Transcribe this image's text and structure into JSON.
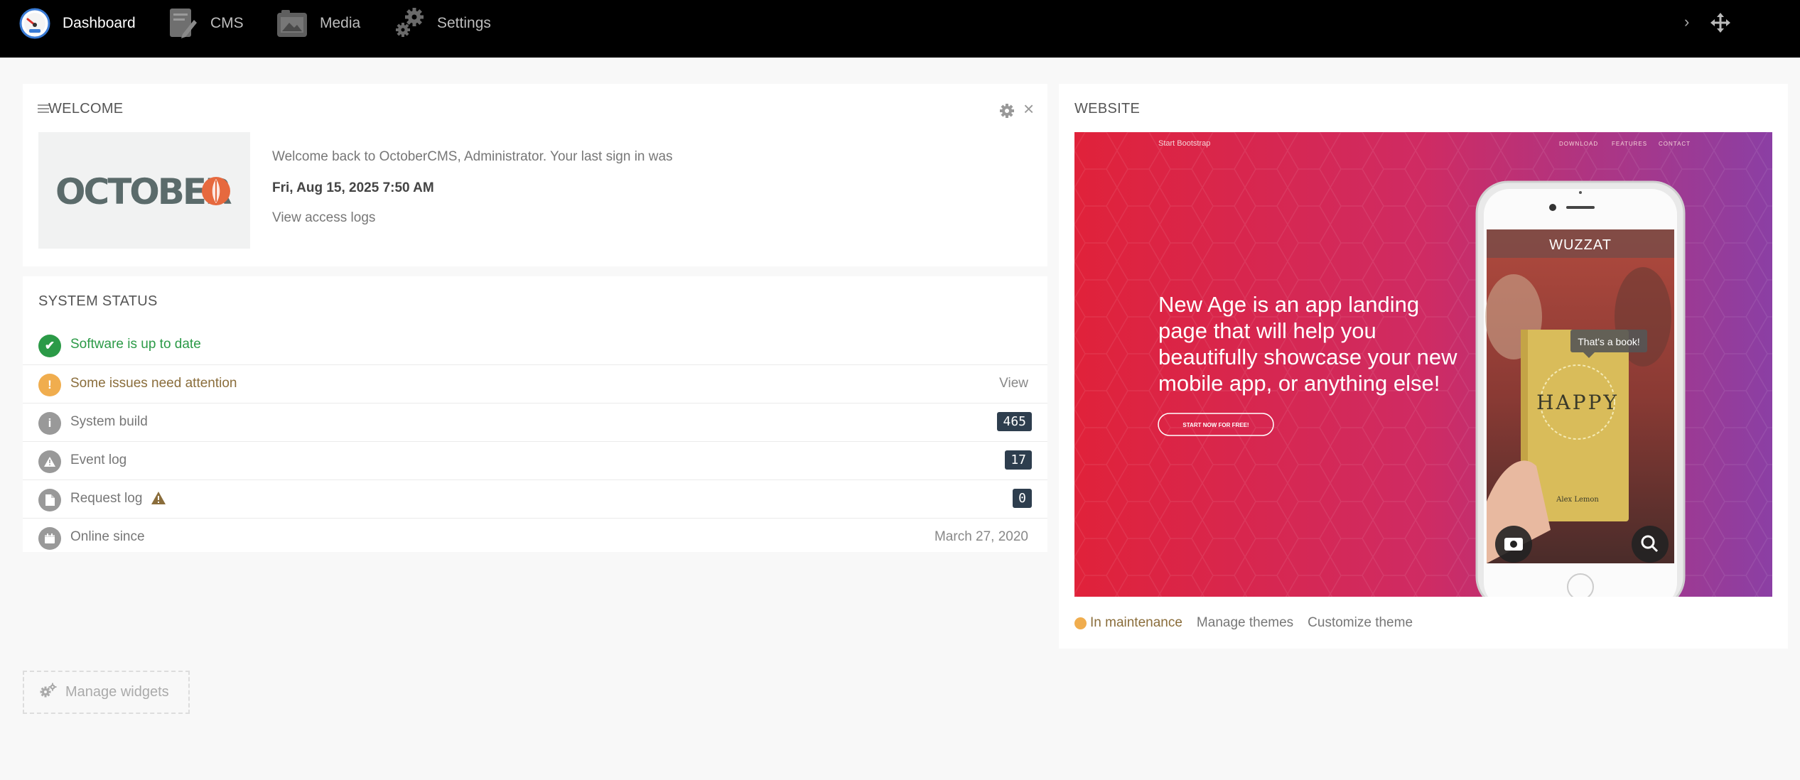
{
  "nav": {
    "items": [
      {
        "label": "Dashboard",
        "icon": "dashboard-gauge-icon"
      },
      {
        "label": "CMS",
        "icon": "cms-pages-icon"
      },
      {
        "label": "Media",
        "icon": "media-icon"
      },
      {
        "label": "Settings",
        "icon": "settings-gears-icon"
      }
    ],
    "right_icons": [
      "chevron-right-icon",
      "move-arrows-icon"
    ]
  },
  "welcome": {
    "title": "WELCOME",
    "logo_text": "OCTOBER",
    "message": "Welcome back to OctoberCMS, Administrator. Your last sign in was",
    "last_signin": "Fri, Aug 15, 2025 7:50 AM",
    "access_logs_link": "View access logs"
  },
  "system_status": {
    "title": "SYSTEM STATUS",
    "rows": [
      {
        "label": "Software is up to date",
        "icon": "check-circle-icon",
        "status": "success"
      },
      {
        "label": "Some issues need attention",
        "icon": "warning-circle-icon",
        "status": "warning",
        "action": "View"
      },
      {
        "label": "System build",
        "icon": "info-circle-icon",
        "badge": "465"
      },
      {
        "label": "Event log",
        "icon": "alert-triangle-icon",
        "badge": "17"
      },
      {
        "label": "Request log",
        "icon": "document-icon",
        "badge": "0",
        "extra_icon": "warning-triangle-icon"
      },
      {
        "label": "Online since",
        "icon": "calendar-icon",
        "value": "March 27, 2020"
      }
    ]
  },
  "website": {
    "title": "WEBSITE",
    "preview": {
      "brand": "Start Bootstrap",
      "nav_links": [
        "DOWNLOAD",
        "FEATURES",
        "CONTACT"
      ],
      "headline_lines": [
        "New Age is an app landing",
        "page that will help you",
        "beautifully showcase your new",
        "mobile app, or anything else!"
      ],
      "cta": "START NOW FOR FREE!",
      "phone_app_name": "WUZZAT",
      "phone_tooltip": "That's a book!",
      "book_title": "HAPPY",
      "book_author": "Alex Lemon"
    },
    "status": "In maintenance",
    "links": [
      "Manage themes",
      "Customize theme"
    ]
  },
  "manage_widgets_label": "Manage widgets",
  "colors": {
    "nav_bg": "#000000",
    "success": "#2b9a47",
    "warning": "#f0ad4e",
    "warning_text": "#8a6d3b",
    "badge": "#2e3e4e",
    "october_orange": "#e6693e"
  }
}
